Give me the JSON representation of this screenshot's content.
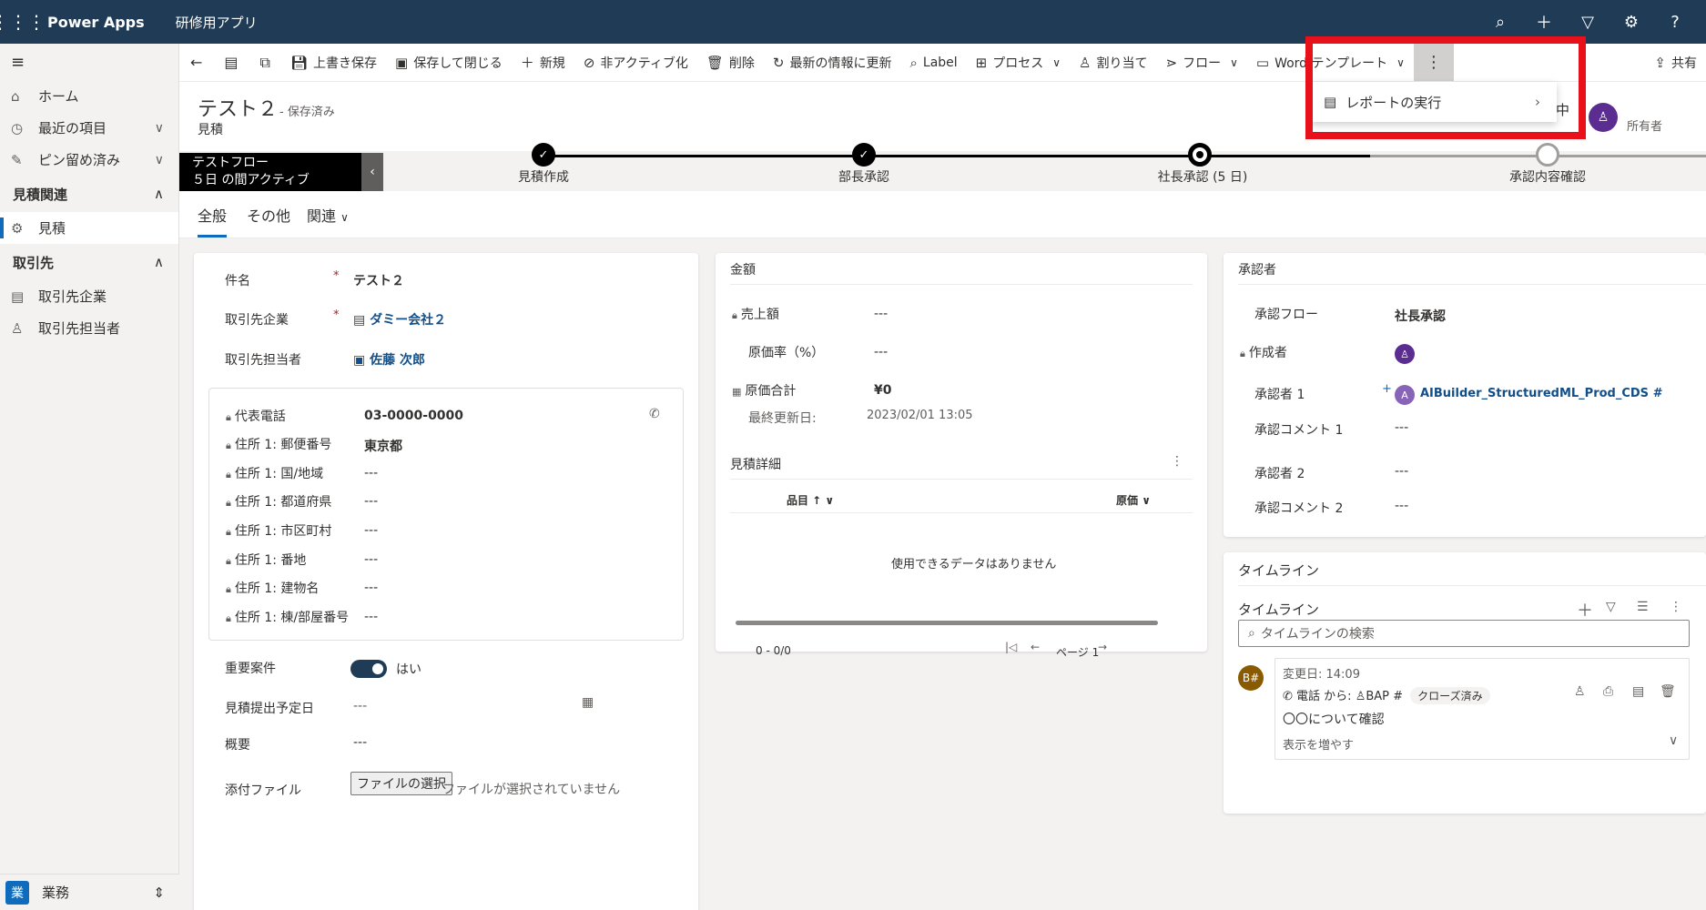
{
  "topbar": {
    "app_name": "Power Apps",
    "env_name": "研修用アプリ",
    "icons": [
      "search-icon",
      "plus-icon",
      "filter-icon",
      "settings-icon",
      "help-icon"
    ]
  },
  "sidebar": {
    "items": [
      {
        "label": "ホーム",
        "icon": "home-icon"
      },
      {
        "label": "最近の項目",
        "icon": "clock-icon"
      },
      {
        "label": "ピン留め済み",
        "icon": "pin-icon"
      }
    ],
    "groups": [
      {
        "label": "見積関連",
        "items": [
          {
            "label": "見積",
            "icon": "quote-icon",
            "active": true
          }
        ]
      },
      {
        "label": "取引先",
        "items": [
          {
            "label": "取引先企業",
            "icon": "building-icon"
          },
          {
            "label": "取引先担当者",
            "icon": "person-icon"
          }
        ]
      }
    ],
    "footer": {
      "badge": "業",
      "label": "業務"
    }
  },
  "cmdbar": {
    "save": "上書き保存",
    "save_close": "保存して閉じる",
    "new": "新規",
    "deactivate": "非アクティブ化",
    "delete": "削除",
    "refresh": "最新の情報に更新",
    "label": "Label",
    "process": "プロセス",
    "assign": "割り当て",
    "flow": "フロー",
    "word_template": "Word テンプレート",
    "share": "共有"
  },
  "dropdown": {
    "run_report": "レポートの実行"
  },
  "header": {
    "title": "テスト２",
    "status": "- 保存済み",
    "entity": "見積",
    "owner_label": "所有者",
    "owner_partial": "中"
  },
  "bpf": {
    "flow_name": "テストフロー",
    "active_duration": "５日 の間アクティブ",
    "stages": [
      {
        "label": "見積作成",
        "state": "done"
      },
      {
        "label": "部長承認",
        "state": "done"
      },
      {
        "label": "社長承認 (5 日)",
        "state": "active"
      },
      {
        "label": "承認内容確認",
        "state": "todo"
      }
    ]
  },
  "tabs": {
    "general": "全般",
    "other": "その他",
    "related": "関連"
  },
  "general_card": {
    "subject_label": "件名",
    "subject_value": "テスト２",
    "account_label": "取引先企業",
    "account_value": "ダミー会社２",
    "contact_label": "取引先担当者",
    "contact_value": "佐藤 次郎",
    "address_fields": [
      {
        "label": "代表電話",
        "value": "03-0000-0000"
      },
      {
        "label": "住所 1: 郵便番号",
        "value": "東京都"
      },
      {
        "label": "住所 1: 国/地域",
        "value": "---"
      },
      {
        "label": "住所 1: 都道府県",
        "value": "---"
      },
      {
        "label": "住所 1: 市区町村",
        "value": "---"
      },
      {
        "label": "住所 1: 番地",
        "value": "---"
      },
      {
        "label": "住所 1: 建物名",
        "value": "---"
      },
      {
        "label": "住所 1: 棟/部屋番号",
        "value": "---"
      }
    ],
    "important_label": "重要案件",
    "important_value": "はい",
    "due_label": "見積提出予定日",
    "due_value": "---",
    "summary_label": "概要",
    "summary_value": "---",
    "attach_label": "添付ファイル",
    "file_button": "ファイルの選択",
    "file_none": "ファイルが選択されていません"
  },
  "amount_card": {
    "title": "金額",
    "sales_label": "売上額",
    "sales_value": "---",
    "cost_rate_label": "原価率（%）",
    "cost_rate_value": "---",
    "cost_total_label": "原価合計",
    "cost_total_value": "¥0",
    "updated_label": "最終更新日:",
    "updated_value": "2023/02/01 13:05",
    "detail_title": "見積詳細",
    "col_item": "品目 ↑",
    "col_cost": "原価",
    "empty": "使用できるデータはありません",
    "paging": "0 - 0/0",
    "page": "ページ 1"
  },
  "approver_card": {
    "title": "承認者",
    "flow_label": "承認フロー",
    "flow_value": "社長承認",
    "creator_label": "作成者",
    "approver1_label": "承認者 1",
    "approver1_value": "AIBuilder_StructuredML_Prod_CDS #",
    "approver1_initial": "A",
    "comment1_label": "承認コメント 1",
    "comment1_value": "---",
    "approver2_label": "承認者 2",
    "approver2_value": "---",
    "comment2_label": "承認コメント 2",
    "comment2_value": "---"
  },
  "timeline_card": {
    "title": "タイムライン",
    "sub_title": "タイムライン",
    "search_placeholder": "タイムラインの検索",
    "item": {
      "avatar": "B#",
      "modified": "変更日: 14:09",
      "from_text": "電話 から:",
      "from_who": "BAP #",
      "status_chip": "クローズ済み",
      "body": "〇〇について確認",
      "more": "表示を増やす"
    }
  },
  "colors": {
    "topbar": "#1f3b55",
    "accent": "#0f6cbd",
    "highlight": "#e8101a",
    "avatar": "#5c2d91"
  }
}
